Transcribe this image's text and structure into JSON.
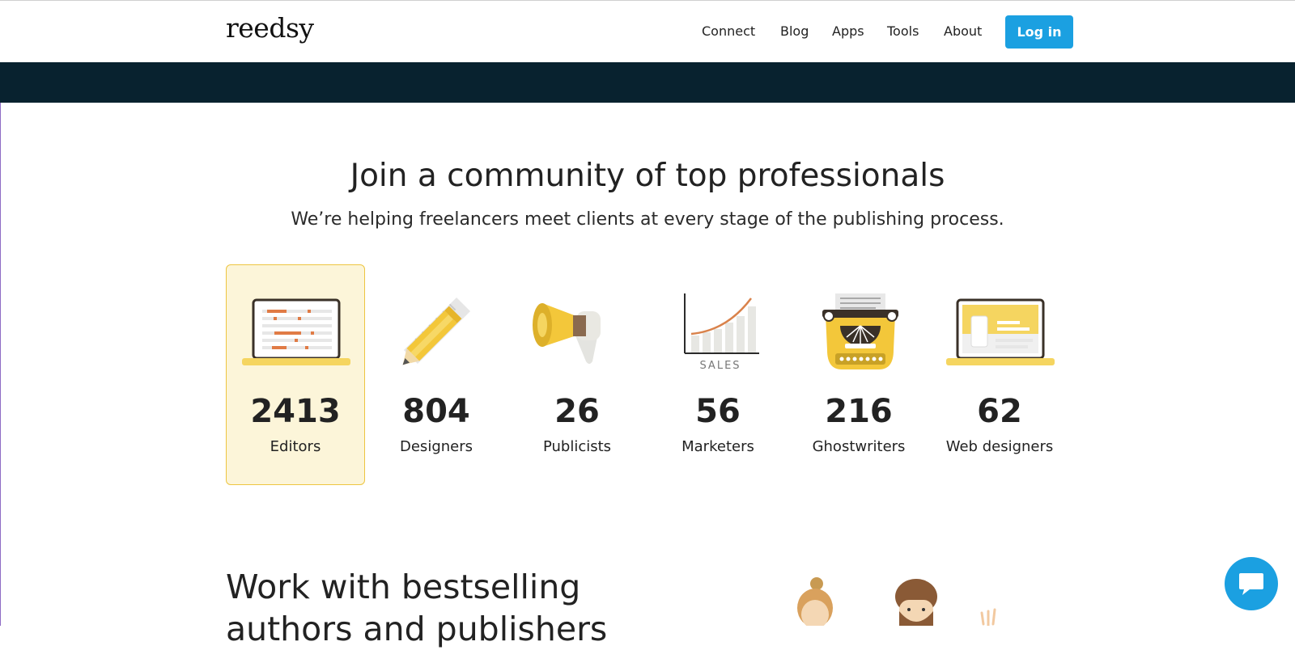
{
  "header": {
    "logo": "reedsy",
    "nav": [
      "Connect",
      "Blog",
      "Apps",
      "Tools",
      "About"
    ],
    "login_label": "Log in"
  },
  "hero": {
    "title": "Join a community of top professionals",
    "subtitle": "We’re helping freelancers meet clients at every stage of the publishing process."
  },
  "categories": [
    {
      "count": "2413",
      "label": "Editors",
      "icon": "laptop-edit-icon",
      "selected": true
    },
    {
      "count": "804",
      "label": "Designers",
      "icon": "pencil-ruler-icon",
      "selected": false
    },
    {
      "count": "26",
      "label": "Publicists",
      "icon": "megaphone-icon",
      "selected": false
    },
    {
      "count": "56",
      "label": "Marketers",
      "icon": "sales-chart-icon",
      "selected": false,
      "icon_text": "SALES"
    },
    {
      "count": "216",
      "label": "Ghostwriters",
      "icon": "typewriter-icon",
      "selected": false
    },
    {
      "count": "62",
      "label": "Web designers",
      "icon": "laptop-web-icon",
      "selected": false
    }
  ],
  "work": {
    "title_line1": "Work with bestselling",
    "title_line2": "authors and publishers"
  },
  "chat": {
    "icon": "chat-icon"
  },
  "colors": {
    "accent": "#1ba0e1",
    "dark_band": "#08222f",
    "yellow": "#f5d560",
    "card_bg": "#fcf5d9",
    "card_border": "#edc541"
  }
}
